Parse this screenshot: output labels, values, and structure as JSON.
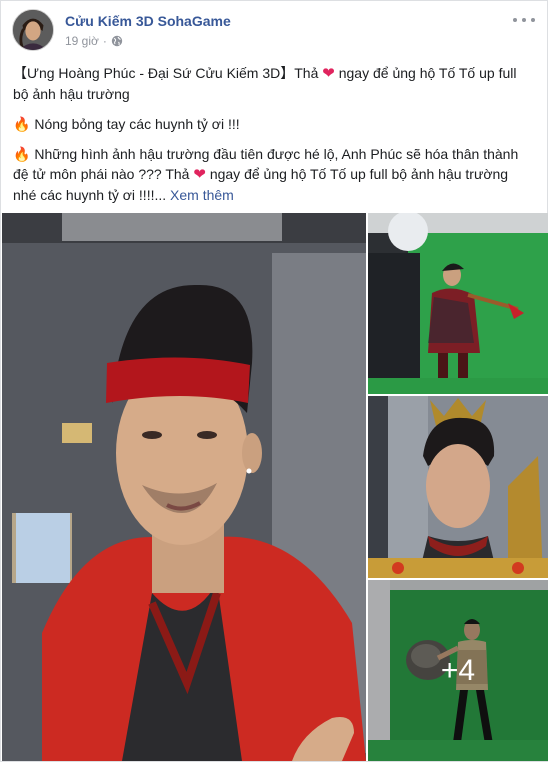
{
  "post": {
    "page_name": "Cửu Kiếm 3D SohaGame",
    "time": "19 giờ",
    "separator": "·",
    "paragraphs": {
      "p1_before": "【Ưng Hoàng Phúc - Đại Sứ Cửu Kiếm 3D】Thả ",
      "p1_after": " ngay để ủng hộ Tố Tố up full bộ ảnh hậu trường",
      "p2": " Nóng bỏng tay các huynh tỷ ơi !!!",
      "p3_before": " Những hình ảnh hậu trường đầu tiên được hé lộ, Anh Phúc sẽ hóa thân thành đệ tử môn phái nào ??? Thả ",
      "p3_after": " ngay để ủng hộ Tố Tố up full bộ ảnh hậu trường nhé các huynh tỷ ơi !!!!...",
      "see_more": " Xem thêm"
    },
    "emoji": {
      "heart": "❤",
      "fire": "🔥"
    },
    "more_photos_label": "+4"
  },
  "icons": {
    "globe": "globe-icon",
    "more": "more-options-icon"
  },
  "colors": {
    "link_blue": "#385898",
    "meta_gray": "#90949c",
    "heart_red": "#e0245e",
    "green_screen": "#2fa54a"
  }
}
